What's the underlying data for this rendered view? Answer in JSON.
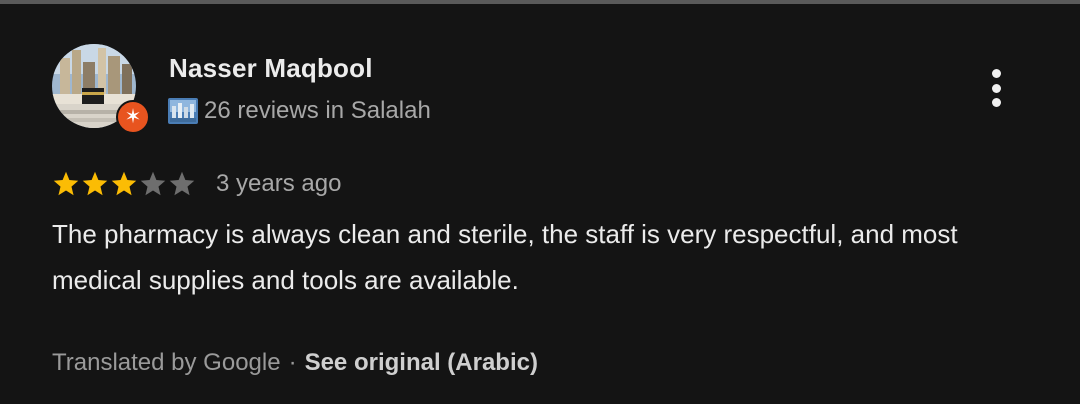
{
  "reviewer": {
    "name": "Nasser Maqbool",
    "meta": "26 reviews in Salalah",
    "avatar_icon": "profile-photo",
    "badge_icon": "local-guide-star-icon"
  },
  "menu": {
    "icon": "more-vert-icon"
  },
  "review": {
    "rating": 3,
    "max_rating": 5,
    "date": "3 years ago",
    "text": "The pharmacy is always clean and sterile, the staff is very respectful, and most medical supplies and tools are available."
  },
  "translation": {
    "translated_by": "Translated by Google",
    "separator": "·",
    "see_original": "See original (Arabic)"
  },
  "colors": {
    "background": "#141414",
    "star_filled": "#fbbc04",
    "star_empty": "#6e6e6e",
    "badge": "#e8541f"
  }
}
